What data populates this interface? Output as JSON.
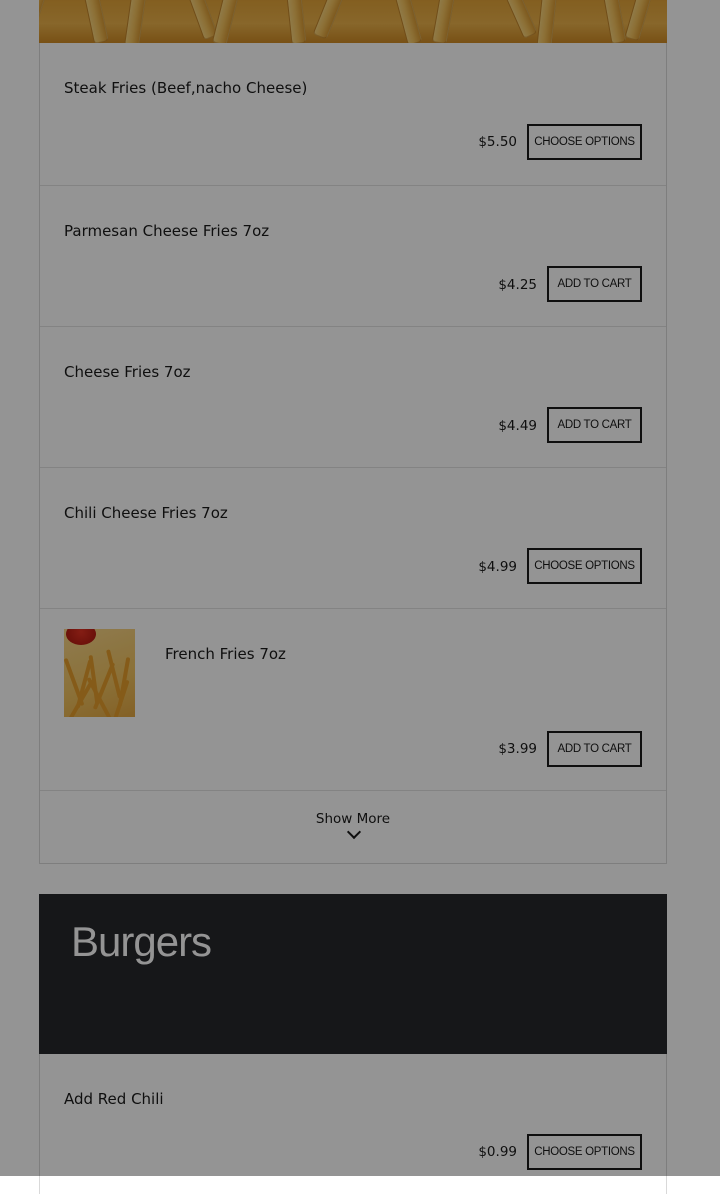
{
  "fries_section": {
    "items": [
      {
        "name": "Steak Fries (Beef,nacho Cheese)",
        "price": "$5.50",
        "button": "Choose Options"
      },
      {
        "name": "Parmesan Cheese Fries 7oz",
        "price": "$4.25",
        "button": "Add to Cart"
      },
      {
        "name": "Cheese Fries 7oz",
        "price": "$4.49",
        "button": "Add to Cart"
      },
      {
        "name": "Chili Cheese Fries 7oz",
        "price": "$4.99",
        "button": "Choose Options"
      },
      {
        "name": "French Fries 7oz",
        "price": "$3.99",
        "button": "Add to Cart"
      }
    ],
    "show_more": "Show More"
  },
  "burgers_section": {
    "title": "Burgers",
    "items": [
      {
        "name": "Add Red Chili",
        "price": "$0.99",
        "button": "Choose Options"
      }
    ]
  },
  "icons": {
    "show_more": "chevron-down-icon"
  },
  "colors": {
    "section_header_bg": "#27282c",
    "overlay": "rgba(0,0,0,0.42)",
    "button_border": "#1a1a1a"
  }
}
